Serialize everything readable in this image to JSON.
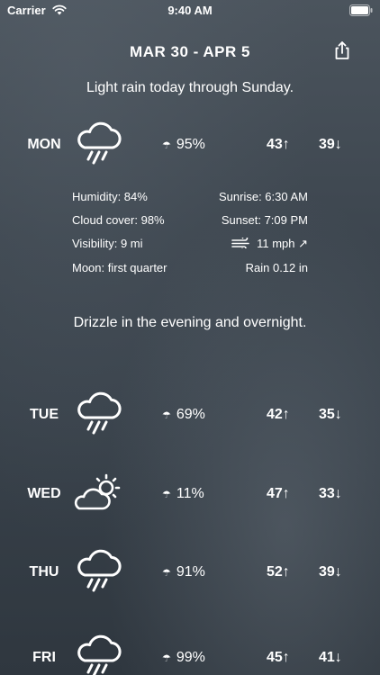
{
  "status_bar": {
    "carrier": "Carrier",
    "time": "9:40 AM"
  },
  "header": {
    "date_range": "MAR 30 - APR 5",
    "share_icon": "share-icon"
  },
  "week_summary": "Light rain today through Sunday.",
  "today": {
    "day": "MON",
    "icon": "rain-cloud-icon",
    "precip_icon": "umbrella-icon",
    "precip": "95%",
    "high": "43↑",
    "low": "39↓",
    "details": {
      "humidity": "Humidity: 84%",
      "cloud_cover": "Cloud cover: 98%",
      "visibility": "Visibility: 9 mi",
      "moon": "Moon: first quarter",
      "sunrise": "Sunrise: 6:30 AM",
      "sunset": "Sunset: 7:09 PM",
      "wind_icon": "wind-icon",
      "wind": "11 mph ↗",
      "rain": "Rain 0.12 in"
    },
    "summary": "Drizzle in the evening and overnight."
  },
  "days": [
    {
      "day": "TUE",
      "icon": "rain-cloud-icon",
      "precip": "69%",
      "high": "42↑",
      "low": "35↓"
    },
    {
      "day": "WED",
      "icon": "partly-sunny-icon",
      "precip": "11%",
      "high": "47↑",
      "low": "33↓"
    },
    {
      "day": "THU",
      "icon": "rain-cloud-icon",
      "precip": "91%",
      "high": "52↑",
      "low": "39↓"
    },
    {
      "day": "FRI",
      "icon": "rain-cloud-icon",
      "precip": "99%",
      "high": "45↑",
      "low": "41↓"
    }
  ],
  "colors": {
    "text": "#ffffff",
    "background": "#3d464f"
  }
}
